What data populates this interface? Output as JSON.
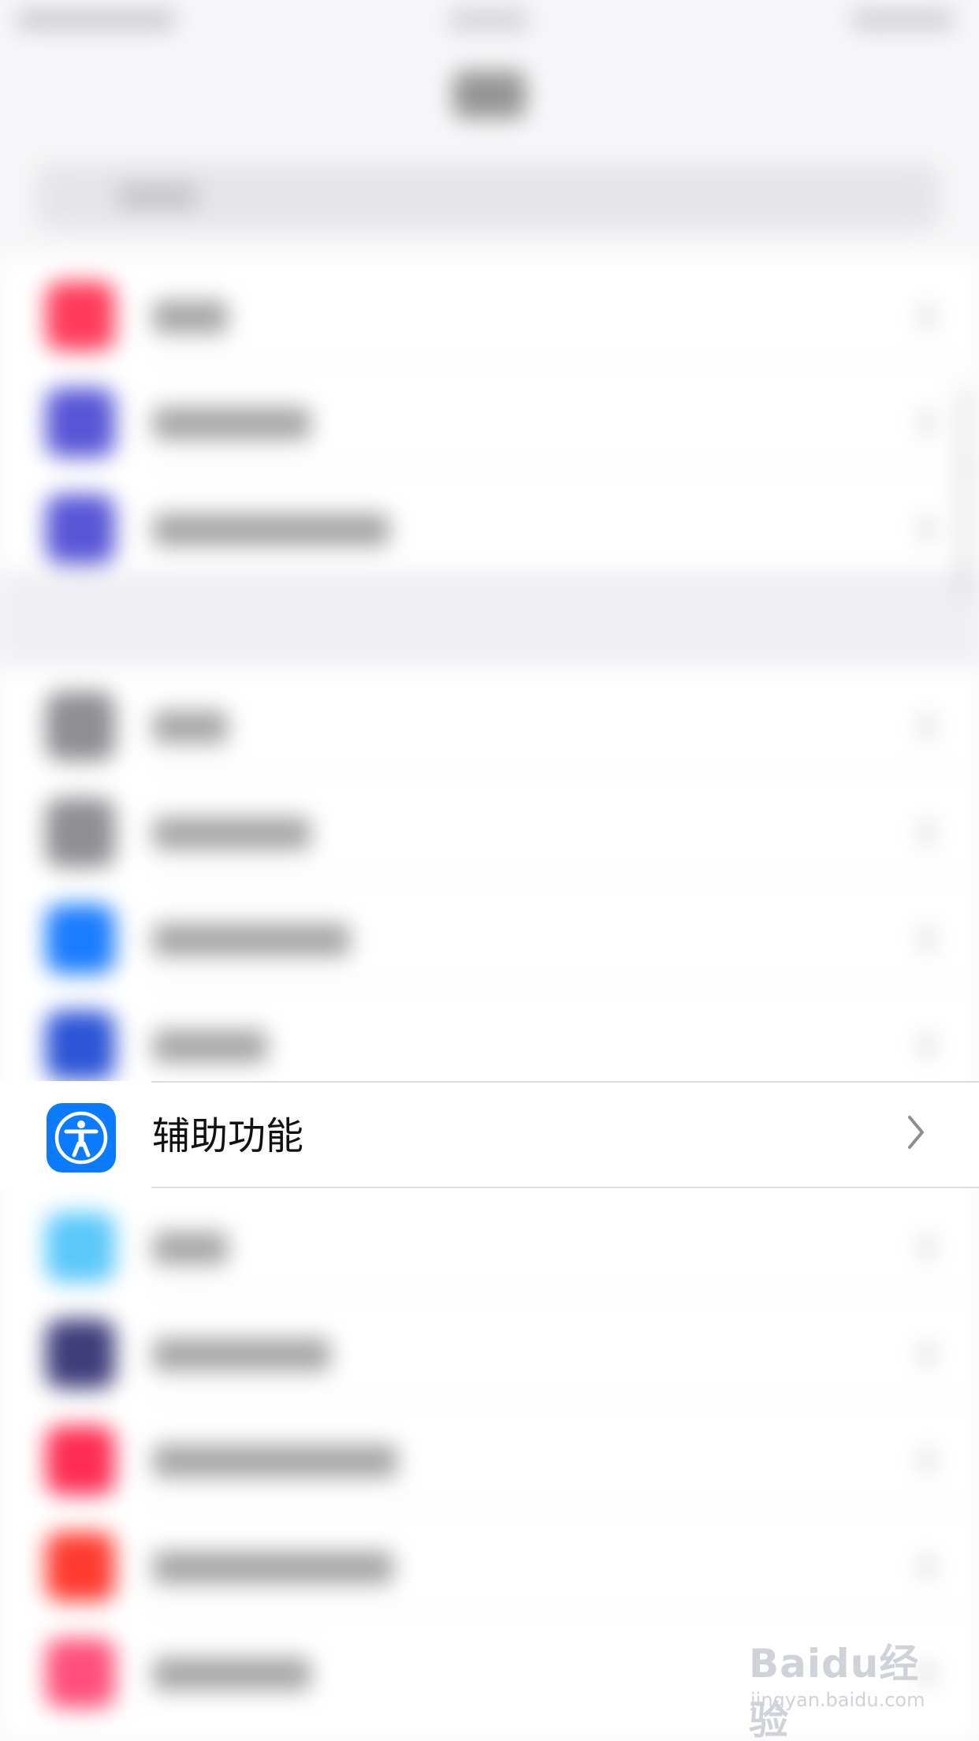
{
  "focused_item": {
    "label": "辅助功能",
    "icon": "accessibility-icon",
    "icon_color": "#0A7AFF"
  },
  "blurred_rows": [
    {
      "icon_color": "#ff3b5c"
    },
    {
      "icon_color": "#5856d6"
    },
    {
      "icon_color": "#5856d6"
    },
    {
      "icon_color": "#8e8e93"
    },
    {
      "icon_color": "#8e8e93"
    },
    {
      "icon_color": "#1a7cff"
    },
    {
      "icon_color": "#2c54d6"
    },
    {
      "icon_color": "#5ac8fa"
    },
    {
      "icon_color": "#3f3d7a"
    },
    {
      "icon_color": "#ff2d55"
    },
    {
      "icon_color": "#ff3b30"
    },
    {
      "icon_color": "#ff4f7a"
    }
  ],
  "watermark": {
    "brand": "Baidu经验",
    "url": "jingyan.baidu.com"
  }
}
